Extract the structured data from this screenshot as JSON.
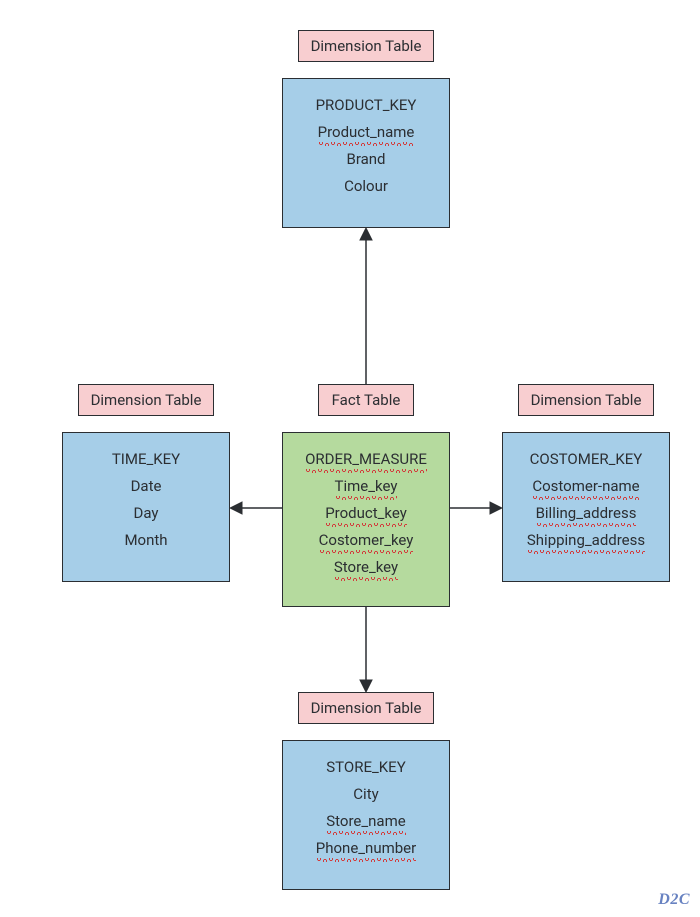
{
  "labels": {
    "dimension_top": "Dimension Table",
    "dimension_left": "Dimension Table",
    "dimension_right": "Dimension Table",
    "dimension_bottom": "Dimension Table",
    "fact": "Fact Table"
  },
  "tables": {
    "product": {
      "rows": [
        {
          "text": "PRODUCT_KEY",
          "squiggle": false
        },
        {
          "text": "Product_name",
          "squiggle": true
        },
        {
          "text": "Brand",
          "squiggle": false
        },
        {
          "text": "Colour",
          "squiggle": false
        }
      ]
    },
    "time": {
      "rows": [
        {
          "text": "TIME_KEY",
          "squiggle": false
        },
        {
          "text": "Date",
          "squiggle": false
        },
        {
          "text": "Day",
          "squiggle": false
        },
        {
          "text": "Month",
          "squiggle": false
        }
      ]
    },
    "order": {
      "rows": [
        {
          "text": "ORDER_MEASURE",
          "squiggle": true
        },
        {
          "text": "Time_key",
          "squiggle": true
        },
        {
          "text": "Product_key",
          "squiggle": true
        },
        {
          "text": "Costomer_key",
          "squiggle": true
        },
        {
          "text": "Store_key",
          "squiggle": true
        }
      ]
    },
    "customer": {
      "rows": [
        {
          "text": "COSTOMER_KEY",
          "squiggle": false
        },
        {
          "text": "Costomer-name",
          "squiggle": true
        },
        {
          "text": "Billing_address",
          "squiggle": true
        },
        {
          "text": "Shipping_address",
          "squiggle": true
        }
      ]
    },
    "store": {
      "rows": [
        {
          "text": "STORE_KEY",
          "squiggle": false
        },
        {
          "text": "City",
          "squiggle": false
        },
        {
          "text": "Store_name",
          "squiggle": true
        },
        {
          "text": "Phone_number",
          "squiggle": true
        }
      ]
    }
  },
  "watermark": "D2C"
}
